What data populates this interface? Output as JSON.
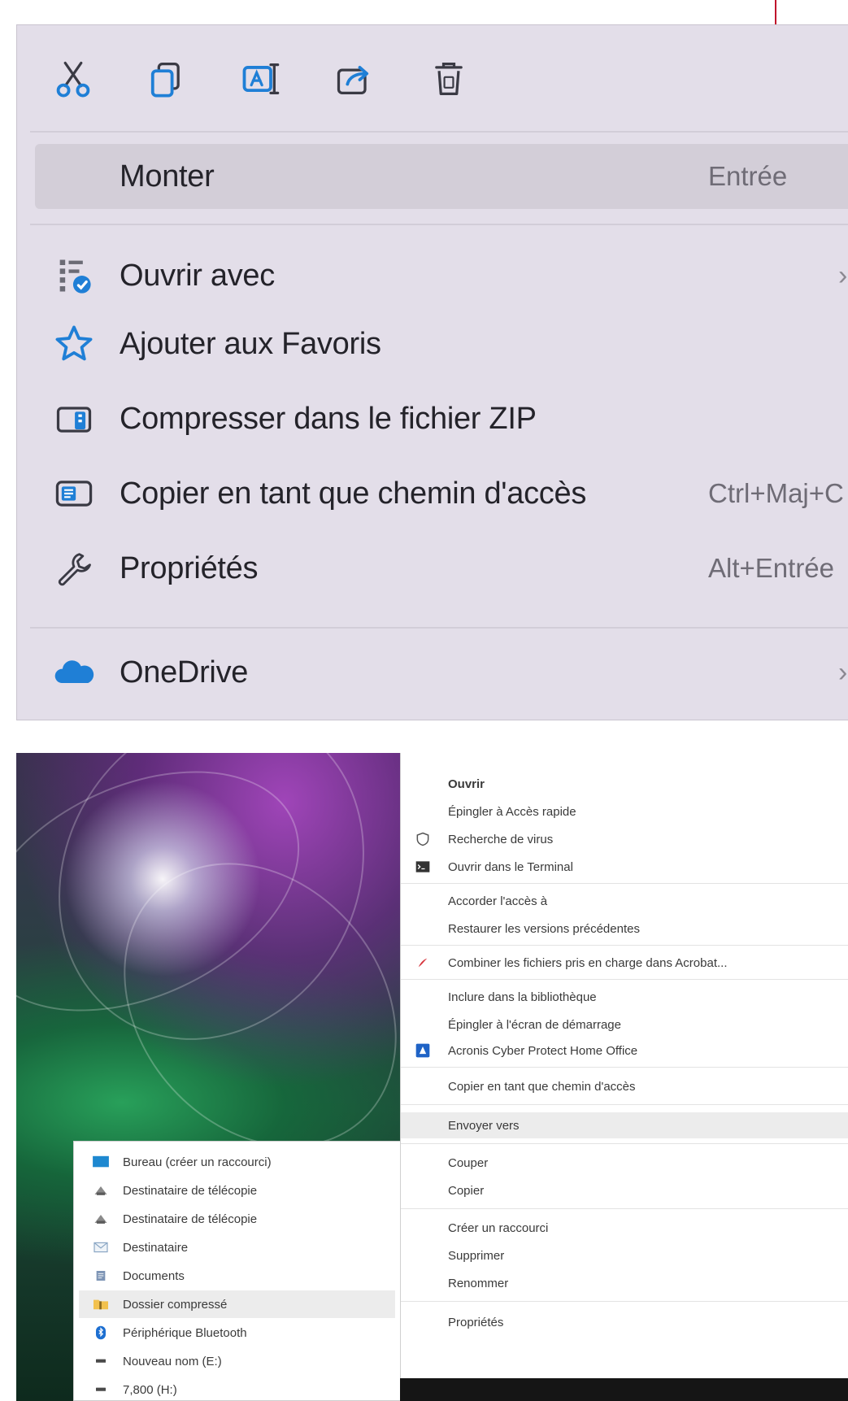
{
  "win11_menu": {
    "toolbar": [
      {
        "name": "cut-icon"
      },
      {
        "name": "copy-icon"
      },
      {
        "name": "rename-icon"
      },
      {
        "name": "share-icon"
      },
      {
        "name": "delete-icon"
      }
    ],
    "items": [
      {
        "label": "Monter",
        "shortcut": "Entrée",
        "icon": ""
      },
      {
        "label": "Ouvrir avec",
        "shortcut": "",
        "icon": "open-with-icon",
        "submenu": "›"
      },
      {
        "label": "Ajouter aux Favoris",
        "shortcut": "",
        "icon": "star-icon"
      },
      {
        "label": "Compresser dans le fichier ZIP",
        "shortcut": "",
        "icon": "zip-icon"
      },
      {
        "label": "Copier en tant que chemin d'accès",
        "shortcut": "Ctrl+Maj+C",
        "icon": "copy-path-icon"
      },
      {
        "label": "Propriétés",
        "shortcut": "Alt+Entrée",
        "icon": "wrench-icon"
      },
      {
        "label": "OneDrive",
        "shortcut": "",
        "icon": "onedrive-cloud-icon",
        "submenu": "›"
      }
    ],
    "colors": {
      "accent": "#1f7fd6",
      "pointer": "#c0142c",
      "background": "#e3dee9"
    }
  },
  "classic_menu": {
    "items": [
      {
        "label": "Ouvrir",
        "bold": true,
        "icon": ""
      },
      {
        "label": "Épingler à Accès rapide",
        "icon": ""
      },
      {
        "label": "Recherche de virus",
        "icon": "shield-icon"
      },
      {
        "label": "Ouvrir dans le Terminal",
        "icon": "terminal-icon"
      },
      {
        "label": "Accorder l'accès à",
        "icon": ""
      },
      {
        "label": "Restaurer les versions précédentes",
        "icon": ""
      },
      {
        "label": "Combiner les fichiers pris en charge dans Acrobat...",
        "icon": "acrobat-icon"
      },
      {
        "label": "Inclure dans la bibliothèque",
        "icon": ""
      },
      {
        "label": "Épingler à l'écran de démarrage",
        "icon": ""
      },
      {
        "label": "Acronis Cyber Protect Home Office",
        "icon": "acronis-icon"
      },
      {
        "label": "Copier en tant que chemin d'accès",
        "icon": ""
      },
      {
        "label": "Envoyer vers",
        "icon": ""
      },
      {
        "label": "Couper",
        "icon": ""
      },
      {
        "label": "Copier",
        "icon": ""
      },
      {
        "label": "Créer un raccourci",
        "icon": ""
      },
      {
        "label": "Supprimer",
        "icon": ""
      },
      {
        "label": "Renommer",
        "icon": ""
      },
      {
        "label": "Propriétés",
        "icon": ""
      }
    ]
  },
  "sendto_menu": {
    "items": [
      {
        "label": "Bureau (créer un raccourci)",
        "icon": "desktop-icon"
      },
      {
        "label": "Destinataire de télécopie",
        "icon": "fax-icon"
      },
      {
        "label": "Destinataire de télécopie",
        "icon": "fax-icon"
      },
      {
        "label": "Destinataire",
        "icon": "mail-icon"
      },
      {
        "label": "Documents",
        "icon": "documents-icon"
      },
      {
        "label": "Dossier compressé",
        "icon": "zip-folder-icon"
      },
      {
        "label": "Périphérique Bluetooth",
        "icon": "bluetooth-icon"
      },
      {
        "label": "Nouveau nom (E:)",
        "icon": "drive-icon"
      },
      {
        "label": "7,800 (H:)",
        "icon": "drive-icon"
      }
    ]
  }
}
